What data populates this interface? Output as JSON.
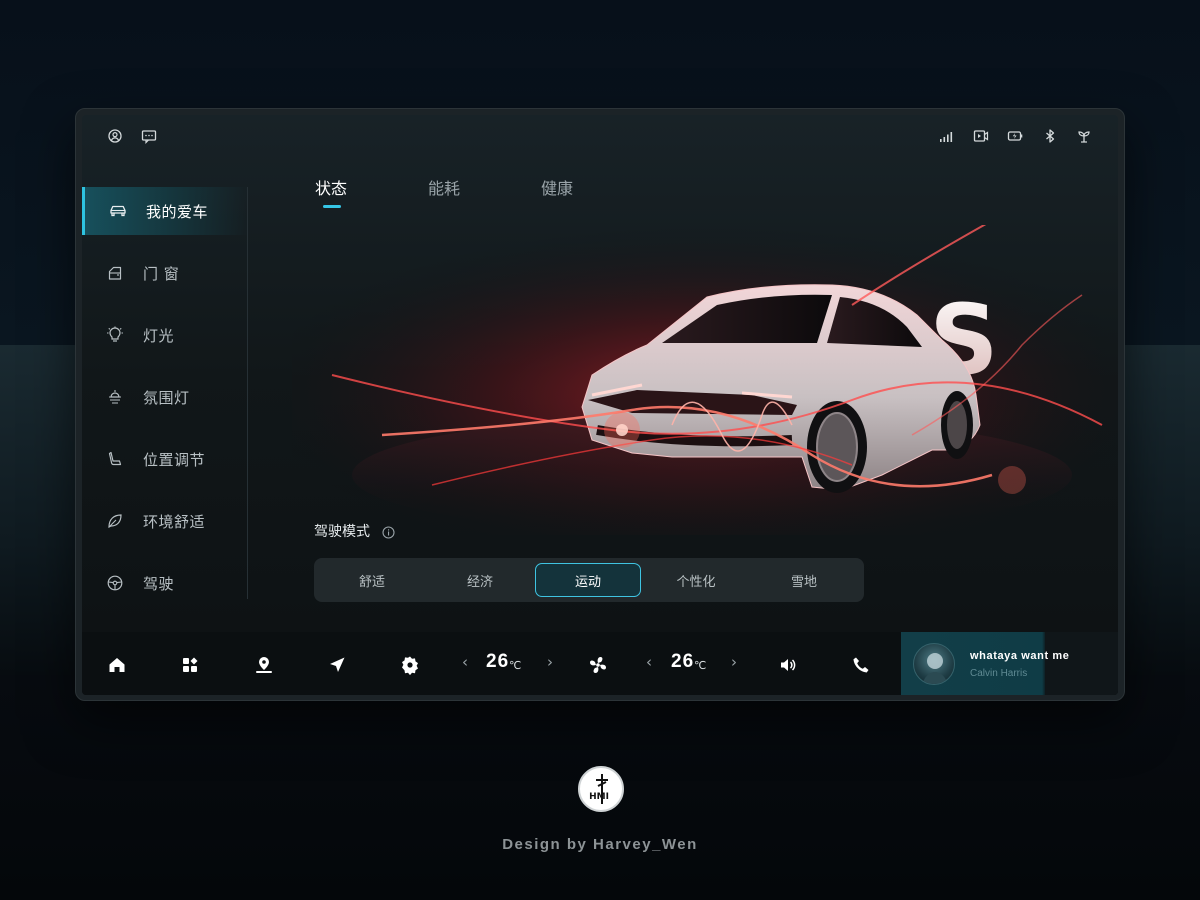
{
  "sidebar": {
    "items": [
      {
        "label": "我的爱车",
        "icon": "car-icon",
        "active": true
      },
      {
        "label": "门 窗",
        "icon": "door-icon",
        "active": false
      },
      {
        "label": "灯光",
        "icon": "light-icon",
        "active": false
      },
      {
        "label": "氛围灯",
        "icon": "ambient-light-icon",
        "active": false
      },
      {
        "label": "位置调节",
        "icon": "seat-icon",
        "active": false
      },
      {
        "label": "环境舒适",
        "icon": "leaf-icon",
        "active": false
      },
      {
        "label": "驾驶",
        "icon": "steering-wheel-icon",
        "active": false
      }
    ]
  },
  "statusbar": {
    "left_icons": [
      "user-icon",
      "message-icon"
    ],
    "right_icons": [
      "signal-icon",
      "dashcam-icon",
      "battery-charging-icon",
      "bluetooth-icon",
      "plant-icon"
    ]
  },
  "tabs": [
    {
      "label": "状态",
      "active": true
    },
    {
      "label": "能耗",
      "active": false
    },
    {
      "label": "健康",
      "active": false
    }
  ],
  "hero": {
    "badge_letter": "S"
  },
  "drive_mode": {
    "title": "驾驶模式",
    "options": [
      "舒适",
      "经济",
      "运动",
      "个性化",
      "雪地"
    ],
    "selected": "运动"
  },
  "dock": {
    "icons": [
      "home-icon",
      "apps-icon",
      "location-pin-icon",
      "navigation-icon",
      "settings-icon",
      "fan-icon",
      "volume-icon",
      "phone-icon"
    ],
    "left_temp": "26",
    "right_temp": "26",
    "temp_unit": "℃",
    "chevron_left": "‹",
    "chevron_right": "›"
  },
  "now_playing": {
    "song": "whataya want me",
    "artist": "Calvin Harris"
  },
  "footer": {
    "logo_text": "HMI",
    "credit": "Design by Harvey_Wen"
  },
  "colors": {
    "accent": "#36c6e6",
    "glow": "#ff3b3b",
    "background": "#05090d"
  }
}
